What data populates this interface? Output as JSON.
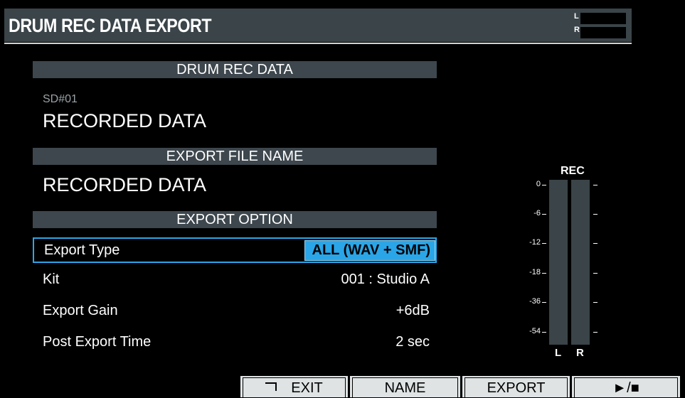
{
  "title": "DRUM REC DATA EXPORT",
  "level_meter": {
    "left_label": "L",
    "right_label": "R"
  },
  "drum_rec_data": {
    "header": "DRUM REC DATA",
    "slot": "SD#01",
    "name": "RECORDED DATA"
  },
  "export_file_name": {
    "header": "EXPORT FILE NAME",
    "value": "RECORDED DATA"
  },
  "export_option": {
    "header": "EXPORT OPTION",
    "params": [
      {
        "label": "Export Type",
        "value": "ALL (WAV + SMF)",
        "selected": true
      },
      {
        "label": "Kit",
        "value": "001 : Studio A"
      },
      {
        "label": "Export Gain",
        "value": "+6dB"
      },
      {
        "label": "Post Export Time",
        "value": "2 sec"
      }
    ]
  },
  "rec_meter": {
    "label": "REC",
    "scale": [
      "0",
      "-6",
      "-12",
      "-18",
      "-36",
      "-54"
    ],
    "left_channel": "L",
    "right_channel": "R"
  },
  "function_buttons": {
    "exit": "EXIT",
    "name": "NAME",
    "export": "EXPORT",
    "play_stop": "►/■"
  },
  "colors": {
    "highlight": "#2aa6e8",
    "section_bg": "#3d474d",
    "button_bg": "#dfe3e4"
  }
}
